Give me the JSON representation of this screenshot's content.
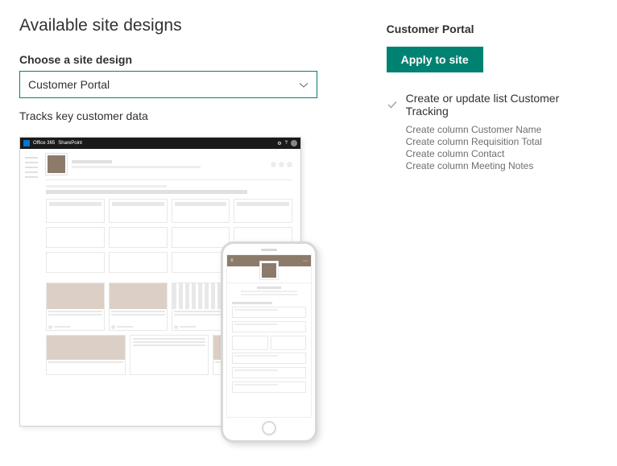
{
  "header": {
    "title": "Available site designs"
  },
  "form": {
    "label": "Choose a site design",
    "selected": "Customer Portal",
    "description": "Tracks key customer data"
  },
  "preview": {
    "suiteBrand1": "Office 365",
    "suiteBrand2": "SharePoint"
  },
  "detail": {
    "title": "Customer Portal",
    "applyLabel": "Apply to site",
    "actions": [
      {
        "label": "Create or update list Customer Tracking",
        "subactions": [
          "Create column Customer Name",
          "Create column Requisition Total",
          "Create column Contact",
          "Create column Meeting Notes"
        ]
      }
    ]
  }
}
